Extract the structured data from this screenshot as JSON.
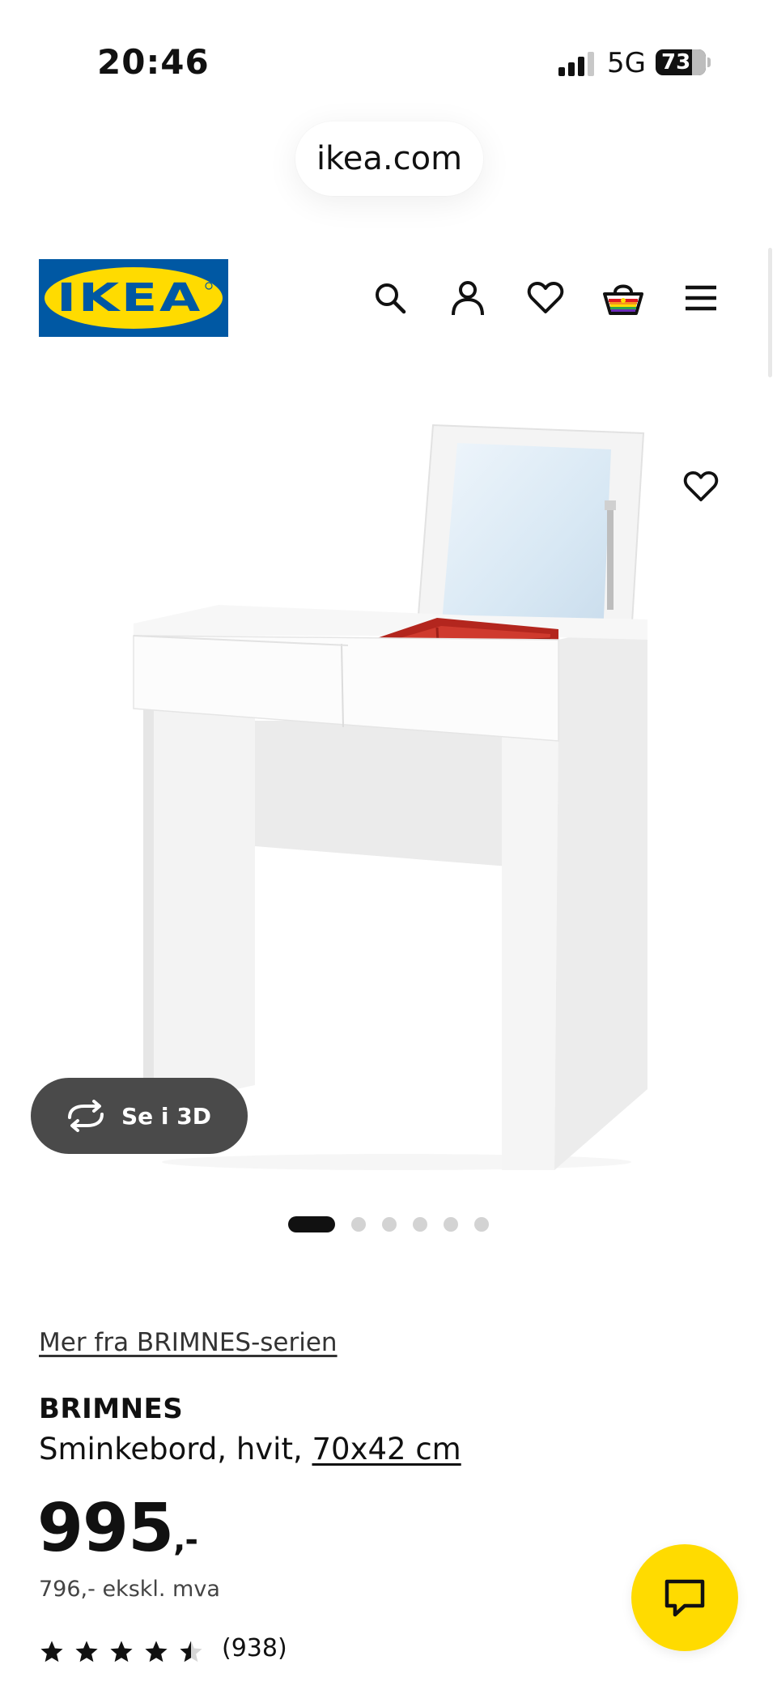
{
  "status_bar": {
    "time": "20:46",
    "network": "5G",
    "battery": "73"
  },
  "browser": {
    "url": "ikea.com"
  },
  "header": {
    "logo_text": "IKEA",
    "brand_colors": {
      "blue": "#0058a3",
      "yellow": "#ffdb00"
    },
    "icons": [
      "search-icon",
      "account-icon",
      "heart-icon",
      "shopping-basket-icon",
      "menu-icon"
    ]
  },
  "gallery": {
    "view_3d_label": "Se i 3D",
    "image_count": 6,
    "active_index": 0
  },
  "product": {
    "series_link": "Mer fra BRIMNES-serien",
    "name": "BRIMNES",
    "description_prefix": "Sminkebord, hvit,",
    "size": "70x42 cm",
    "price": "995",
    "price_suffix": ",-",
    "price_ex_vat": "796,- ekskl. mva",
    "rating": 4.5,
    "rating_max": 5,
    "review_count": "(938)"
  }
}
